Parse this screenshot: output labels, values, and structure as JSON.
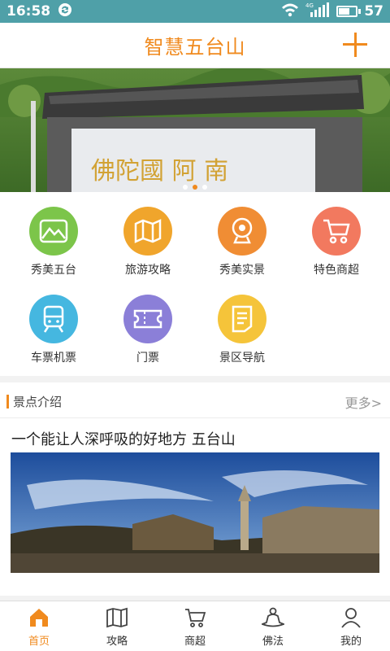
{
  "status_bar": {
    "time": "16:58",
    "battery": "57",
    "battery_level": 0.57,
    "network_badge": "4G"
  },
  "header": {
    "title": "智慧五台山"
  },
  "banner": {
    "inscription": "佛陀國 阿 南"
  },
  "menu": {
    "items": [
      {
        "label": "秀美五台",
        "icon": "mountain-icon",
        "color": "#7cc54a"
      },
      {
        "label": "旅游攻略",
        "icon": "map-icon",
        "color": "#f0a52c"
      },
      {
        "label": "秀美实景",
        "icon": "camera-icon",
        "color": "#f08d34"
      },
      {
        "label": "特色商超",
        "icon": "shopping-cart-icon",
        "color": "#f2795f"
      },
      {
        "label": "车票机票",
        "icon": "train-icon",
        "color": "#45b7e0"
      },
      {
        "label": "门票",
        "icon": "ticket-icon",
        "color": "#8b7fd8"
      },
      {
        "label": "景区导航",
        "icon": "navigation-icon",
        "color": "#f5c43a"
      }
    ]
  },
  "section": {
    "title": "景点介绍",
    "more": "更多>",
    "headline": "一个能让人深呼吸的好地方 五台山"
  },
  "tabs": [
    {
      "label": "首页",
      "icon": "home-icon",
      "active": true
    },
    {
      "label": "攻略",
      "icon": "book-icon",
      "active": false
    },
    {
      "label": "商超",
      "icon": "cart-icon",
      "active": false
    },
    {
      "label": "佛法",
      "icon": "buddha-icon",
      "active": false
    },
    {
      "label": "我的",
      "icon": "profile-icon",
      "active": false
    }
  ],
  "colors": {
    "accent": "#f08a1e",
    "status_bar": "#4fa0a8"
  }
}
